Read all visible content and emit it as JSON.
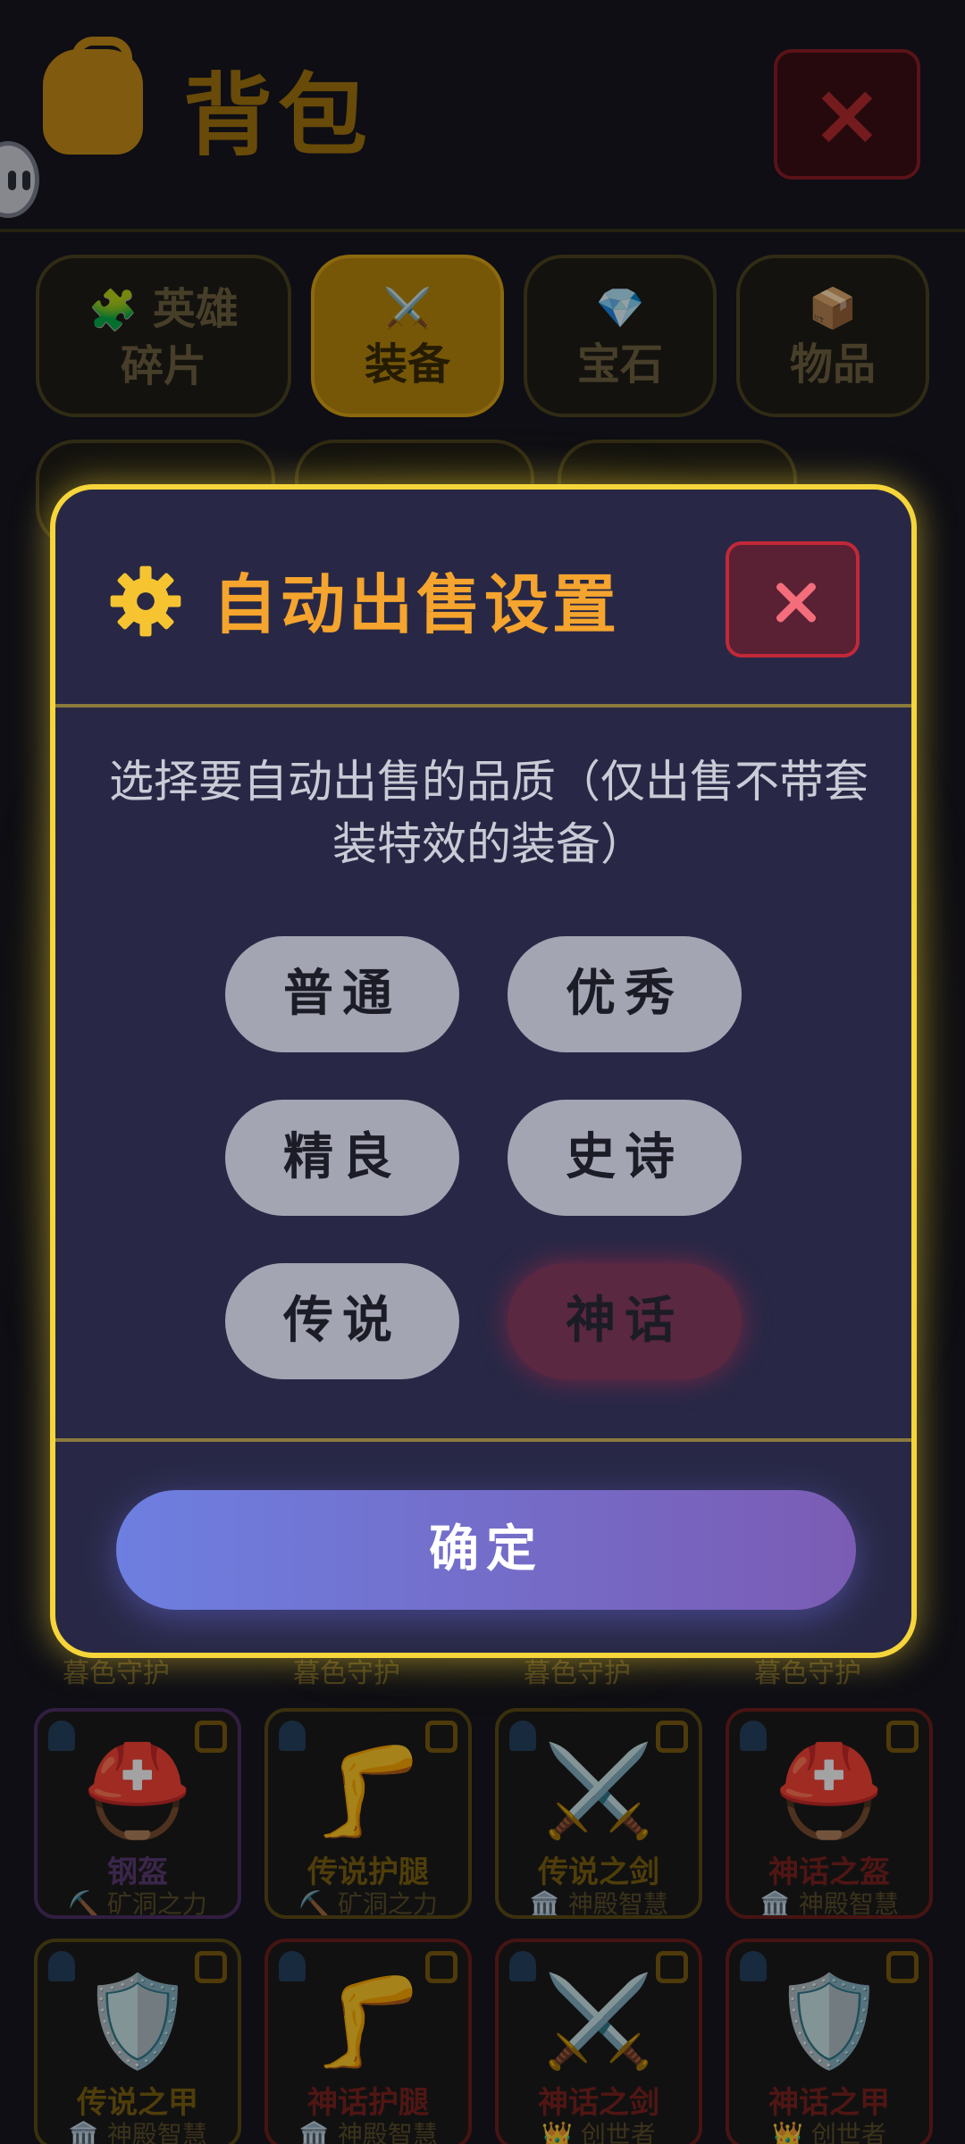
{
  "background": {
    "title": "背包",
    "top_close_label": "×",
    "tabs": [
      {
        "icon": "🧩",
        "label_line1": "英雄",
        "label_line2": "碎片",
        "active": false
      },
      {
        "icon": "⚔️",
        "label_line1": "",
        "label_line2": "装备",
        "active": true
      },
      {
        "icon": "💎",
        "label_line1": "",
        "label_line2": "宝石",
        "active": false
      },
      {
        "icon": "📦",
        "label_line1": "",
        "label_line2": "物品",
        "active": false
      }
    ],
    "row_label": "暮色守护",
    "cards": [
      {
        "icon": "⛑️",
        "name": "钢盔",
        "sub": "⛏️ 矿洞之力",
        "tier": "purple"
      },
      {
        "icon": "🦵",
        "name": "传说护腿",
        "sub": "⛏️ 矿洞之力",
        "tier": "gold"
      },
      {
        "icon": "⚔️",
        "name": "传说之剑",
        "sub": "🏛️ 神殿智慧",
        "tier": "gold"
      },
      {
        "icon": "⛑️",
        "name": "神话之盔",
        "sub": "🏛️ 神殿智慧",
        "tier": "red"
      },
      {
        "icon": "🛡️",
        "name": "传说之甲",
        "sub": "🏛️ 神殿智慧",
        "tier": "gold"
      },
      {
        "icon": "🦵",
        "name": "神话护腿",
        "sub": "🏛️ 神殿智慧",
        "tier": "red"
      },
      {
        "icon": "⚔️",
        "name": "神话之剑",
        "sub": "👑 创世者",
        "tier": "red"
      },
      {
        "icon": "🛡️",
        "name": "神话之甲",
        "sub": "👑 创世者",
        "tier": "red"
      }
    ]
  },
  "modal": {
    "title": "自动出售设置",
    "icon": "gear-icon",
    "description": "选择要自动出售的品质（仅出售不带套装特效的装备）",
    "options": [
      {
        "label": "普通",
        "selected": false
      },
      {
        "label": "优秀",
        "selected": false
      },
      {
        "label": "精良",
        "selected": false
      },
      {
        "label": "史诗",
        "selected": false
      },
      {
        "label": "传说",
        "selected": false
      },
      {
        "label": "神话",
        "selected": true
      }
    ],
    "confirm_label": "确定"
  },
  "colors": {
    "accent_gold": "#f5d53a",
    "title_orange": "#f5a42e",
    "modal_bg": "#282846",
    "option_bg": "#a3a5b3",
    "selected_bg": "#5a2840",
    "close_red": "#c22838"
  }
}
